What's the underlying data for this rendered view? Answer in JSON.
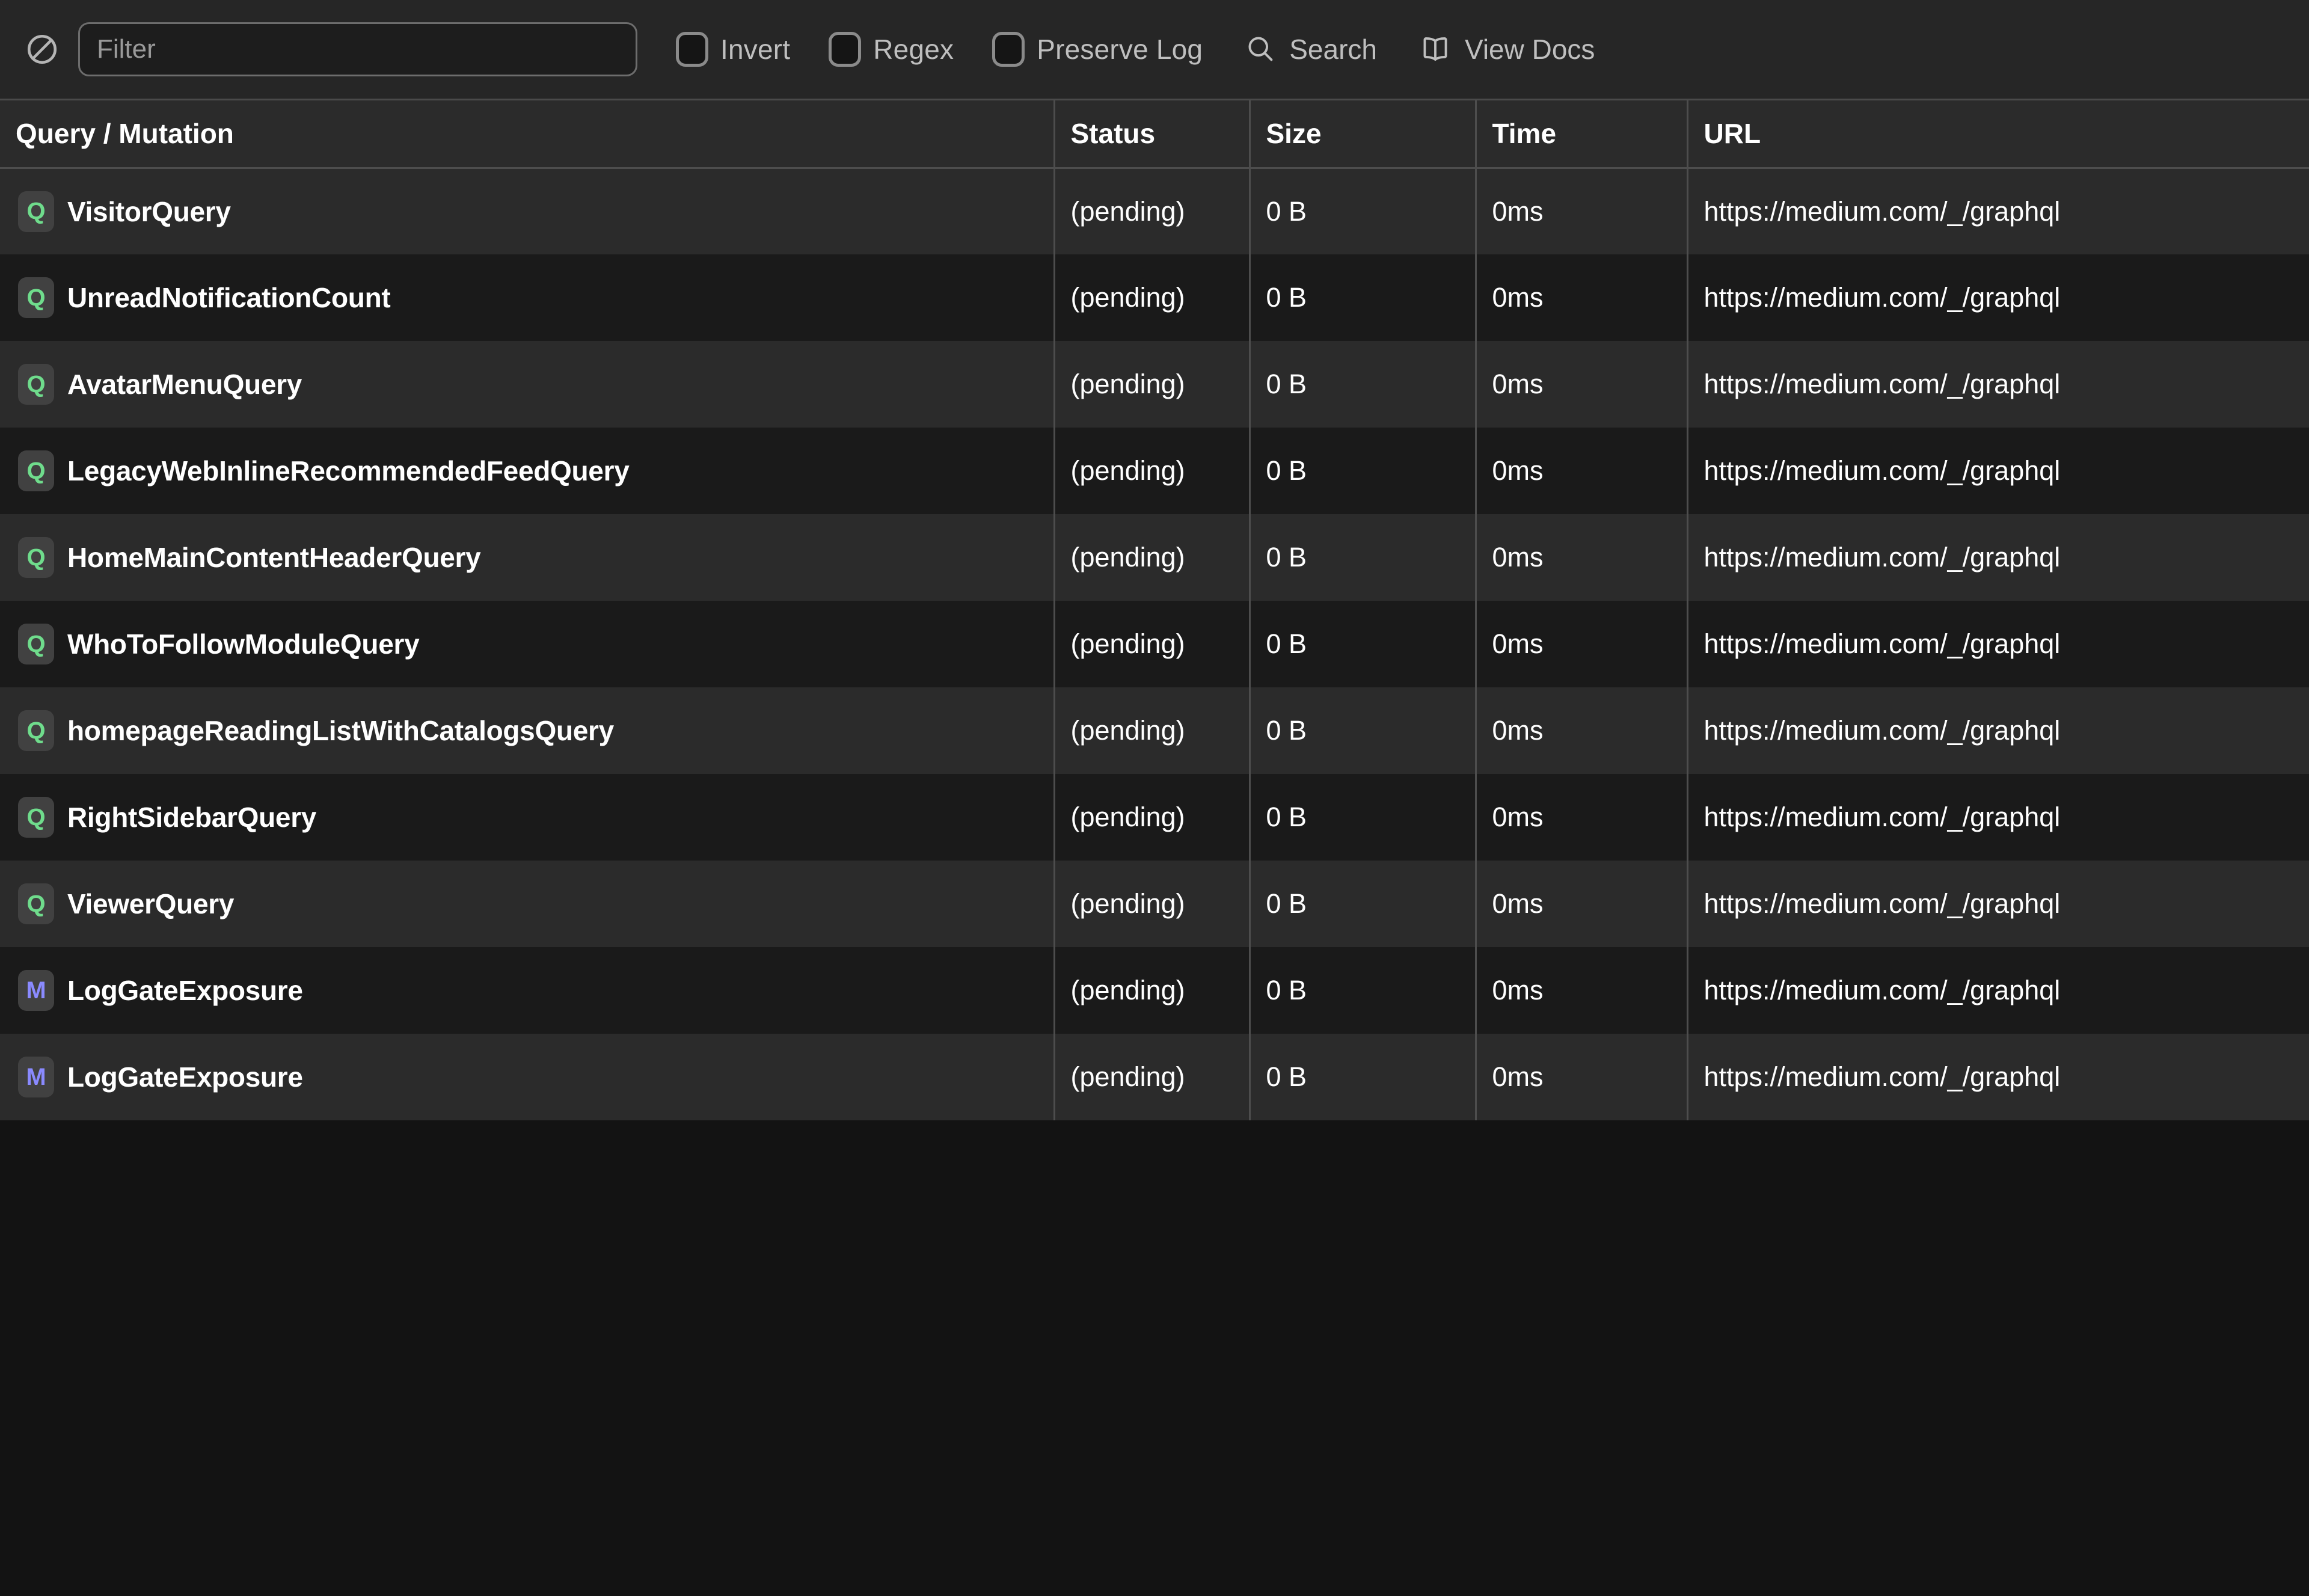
{
  "toolbar": {
    "clear_icon": "ban-icon",
    "filter": {
      "placeholder": "Filter",
      "value": ""
    },
    "checkboxes": [
      {
        "label": "Invert",
        "checked": false
      },
      {
        "label": "Regex",
        "checked": false
      },
      {
        "label": "Preserve Log",
        "checked": false
      }
    ],
    "buttons": [
      {
        "label": "Search",
        "icon": "search-icon"
      },
      {
        "label": "View Docs",
        "icon": "book-icon"
      }
    ]
  },
  "table": {
    "columns": [
      {
        "key": "name",
        "label": "Query / Mutation"
      },
      {
        "key": "status",
        "label": "Status"
      },
      {
        "key": "size",
        "label": "Size"
      },
      {
        "key": "time",
        "label": "Time"
      },
      {
        "key": "url",
        "label": "URL"
      }
    ],
    "rows": [
      {
        "badge": "Q",
        "type": "query",
        "name": "VisitorQuery",
        "status": "(pending)",
        "size": "0 B",
        "time": "0ms",
        "url": "https://medium.com/_/graphql"
      },
      {
        "badge": "Q",
        "type": "query",
        "name": "UnreadNotificationCount",
        "status": "(pending)",
        "size": "0 B",
        "time": "0ms",
        "url": "https://medium.com/_/graphql"
      },
      {
        "badge": "Q",
        "type": "query",
        "name": "AvatarMenuQuery",
        "status": "(pending)",
        "size": "0 B",
        "time": "0ms",
        "url": "https://medium.com/_/graphql"
      },
      {
        "badge": "Q",
        "type": "query",
        "name": "LegacyWebInlineRecommendedFeedQuery",
        "status": "(pending)",
        "size": "0 B",
        "time": "0ms",
        "url": "https://medium.com/_/graphql"
      },
      {
        "badge": "Q",
        "type": "query",
        "name": "HomeMainContentHeaderQuery",
        "status": "(pending)",
        "size": "0 B",
        "time": "0ms",
        "url": "https://medium.com/_/graphql"
      },
      {
        "badge": "Q",
        "type": "query",
        "name": "WhoToFollowModuleQuery",
        "status": "(pending)",
        "size": "0 B",
        "time": "0ms",
        "url": "https://medium.com/_/graphql"
      },
      {
        "badge": "Q",
        "type": "query",
        "name": "homepageReadingListWithCatalogsQuery",
        "status": "(pending)",
        "size": "0 B",
        "time": "0ms",
        "url": "https://medium.com/_/graphql"
      },
      {
        "badge": "Q",
        "type": "query",
        "name": "RightSidebarQuery",
        "status": "(pending)",
        "size": "0 B",
        "time": "0ms",
        "url": "https://medium.com/_/graphql"
      },
      {
        "badge": "Q",
        "type": "query",
        "name": "ViewerQuery",
        "status": "(pending)",
        "size": "0 B",
        "time": "0ms",
        "url": "https://medium.com/_/graphql"
      },
      {
        "badge": "M",
        "type": "mutation",
        "name": "LogGateExposure",
        "status": "(pending)",
        "size": "0 B",
        "time": "0ms",
        "url": "https://medium.com/_/graphql"
      },
      {
        "badge": "M",
        "type": "mutation",
        "name": "LogGateExposure",
        "status": "(pending)",
        "size": "0 B",
        "time": "0ms",
        "url": "https://medium.com/_/graphql"
      }
    ]
  },
  "colors": {
    "background": "#131313",
    "toolbar_bg": "#262626",
    "row_odd": "#2b2b2b",
    "row_even": "#1a1a1a",
    "border": "#4d4d4d",
    "query_badge": "#6fdc8c",
    "mutation_badge": "#8a8aff",
    "text": "#ffffff",
    "muted_text": "#bfbfbf"
  }
}
